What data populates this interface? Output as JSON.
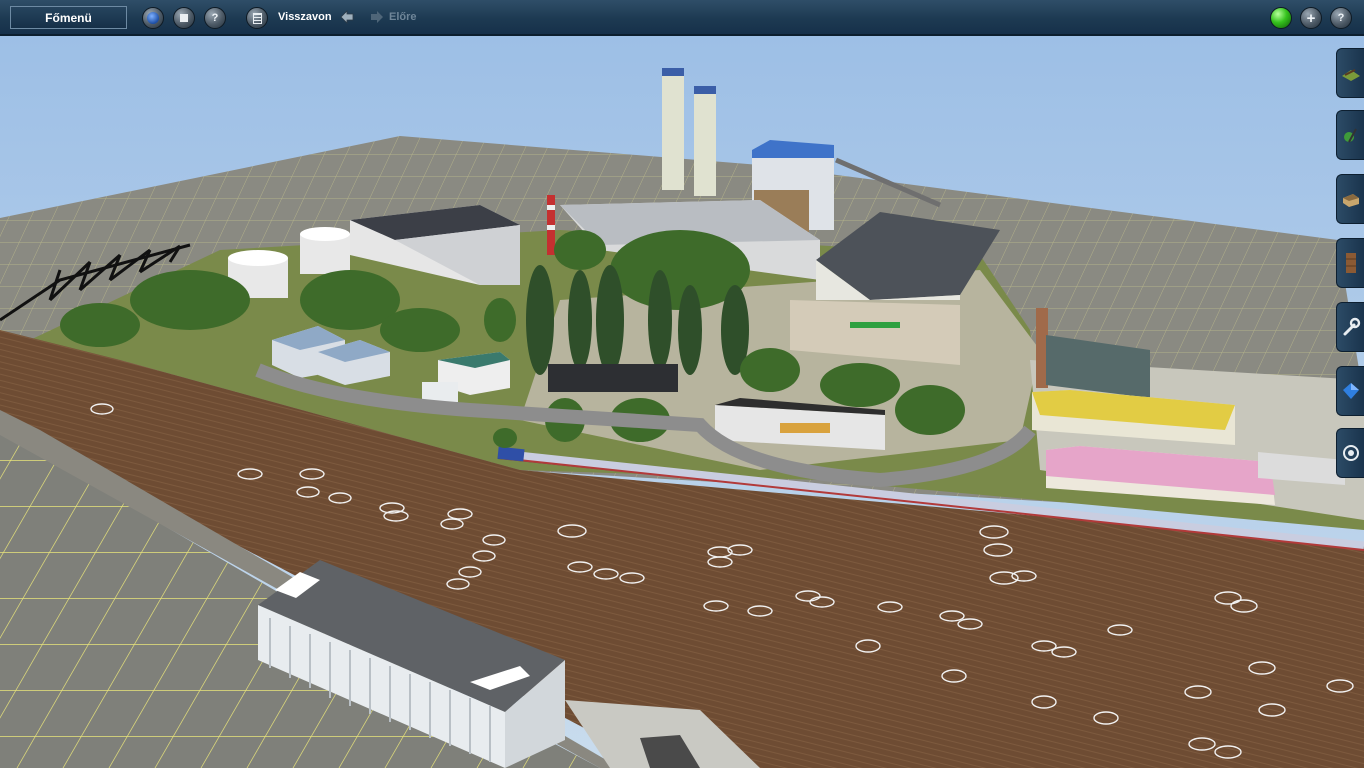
{
  "toolbar": {
    "main_menu_label": "Főmenü",
    "undo_label": "Visszavon",
    "redo_label": "Előre",
    "buttons": {
      "globe": "globe-icon",
      "stop": "stop-icon",
      "question": "question-icon",
      "calculator": "calculator-icon",
      "add": "plus-icon",
      "help": "help-icon"
    },
    "status_light_color": "#35c21d"
  },
  "side_palette": {
    "tools": [
      "track-tool",
      "plant-tool",
      "building-tool",
      "tunnel-tool",
      "wrench-tool",
      "gem-tool",
      "settings-tool"
    ]
  },
  "colors": {
    "sky": "#a9c5e6",
    "toolbar": "#1d3a52",
    "field": "#6b4a33",
    "grid": "#8e8e86"
  }
}
